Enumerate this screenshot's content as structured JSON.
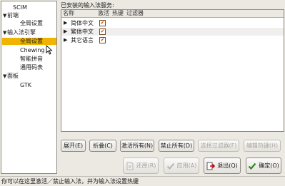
{
  "tree": {
    "root": "SCIM",
    "frontend": "前端",
    "frontend_global": "全局设置",
    "im_engine": "输入法引擎",
    "im_global": "全局设置",
    "chewing": "Chewing",
    "pinyin": "智能拼音",
    "general_table": "通用码表",
    "panel": "面板",
    "gtk": "GTK"
  },
  "main": {
    "title": "已安装的输入法服务:",
    "columns": {
      "name": "名称",
      "enable": "激活",
      "hotkey": "热键",
      "filter": "过滤器"
    },
    "rows": [
      {
        "name": "简体中文",
        "enabled": true
      },
      {
        "name": "繁体中文",
        "enabled": true
      },
      {
        "name": "其它语言",
        "enabled": true
      }
    ]
  },
  "buttons": {
    "expand": "展开(E)",
    "collapse": "折叠(C)",
    "enable_all": "激活所有(N)",
    "disable_all": "禁止所有(D)",
    "select_filters": "选择过滤器(F)",
    "edit_hotkeys": "编辑热键(H)",
    "restore": "还原(R)",
    "apply": "应用(A)",
    "exit": "退出(Q)",
    "ok": "确定(O)"
  },
  "status": "你可以在这里激活／禁止输入法，并为输入法设置热键"
}
